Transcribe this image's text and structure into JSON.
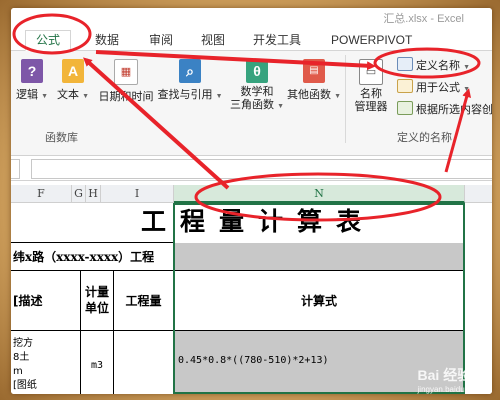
{
  "window": {
    "title": "汇总.xlsx - Excel"
  },
  "tabs": [
    {
      "label": "公式",
      "active": true
    },
    {
      "label": "数据"
    },
    {
      "label": "审阅"
    },
    {
      "label": "视图"
    },
    {
      "label": "开发工具"
    },
    {
      "label": "POWERPIVOT"
    }
  ],
  "ribbon": {
    "function_library": {
      "buttons": [
        {
          "label": "逻辑",
          "icon": "question-icon"
        },
        {
          "label": "文本",
          "icon": "text-a-icon"
        },
        {
          "label": "日期和时间",
          "icon": "calendar-icon"
        },
        {
          "label": "查找与引用",
          "icon": "magnifier-icon"
        },
        {
          "label_line1": "数学和",
          "label_line2": "三角函数",
          "icon": "theta-icon"
        },
        {
          "label": "其他函数",
          "icon": "more-functions-icon"
        }
      ],
      "group_label": "函数库"
    },
    "defined_names": {
      "name_manager_line1": "名称",
      "name_manager_line2": "管理器",
      "define_name": "定义名称",
      "use_in_formula": "用于公式",
      "create_from_selection": "根据所选内容创",
      "group_label": "定义的名称"
    }
  },
  "columns": [
    "F",
    "G",
    "H",
    "I",
    "N"
  ],
  "sheet": {
    "title": "工程量计算表",
    "subtitle": "纬x路（xxxx-xxxx）工程",
    "headers": {
      "description": "[描述",
      "unit_line1": "计量",
      "unit_line2": "单位",
      "quantity": "工程量",
      "formula": "计算式"
    },
    "row1": {
      "desc_line1": "挖方",
      "desc_line2": "8土",
      "desc_line3": "m",
      "desc_line4": "[图纸",
      "unit": "m3",
      "formula": "0.45*0.8*((780-510)*2+13)"
    }
  },
  "watermark": {
    "brand": "Bai 经验",
    "url": "jingyan.baidu.com"
  },
  "colors": {
    "annotation": "#e8232a",
    "excel_green": "#217346",
    "highlight_gray": "#c8c8c8"
  }
}
